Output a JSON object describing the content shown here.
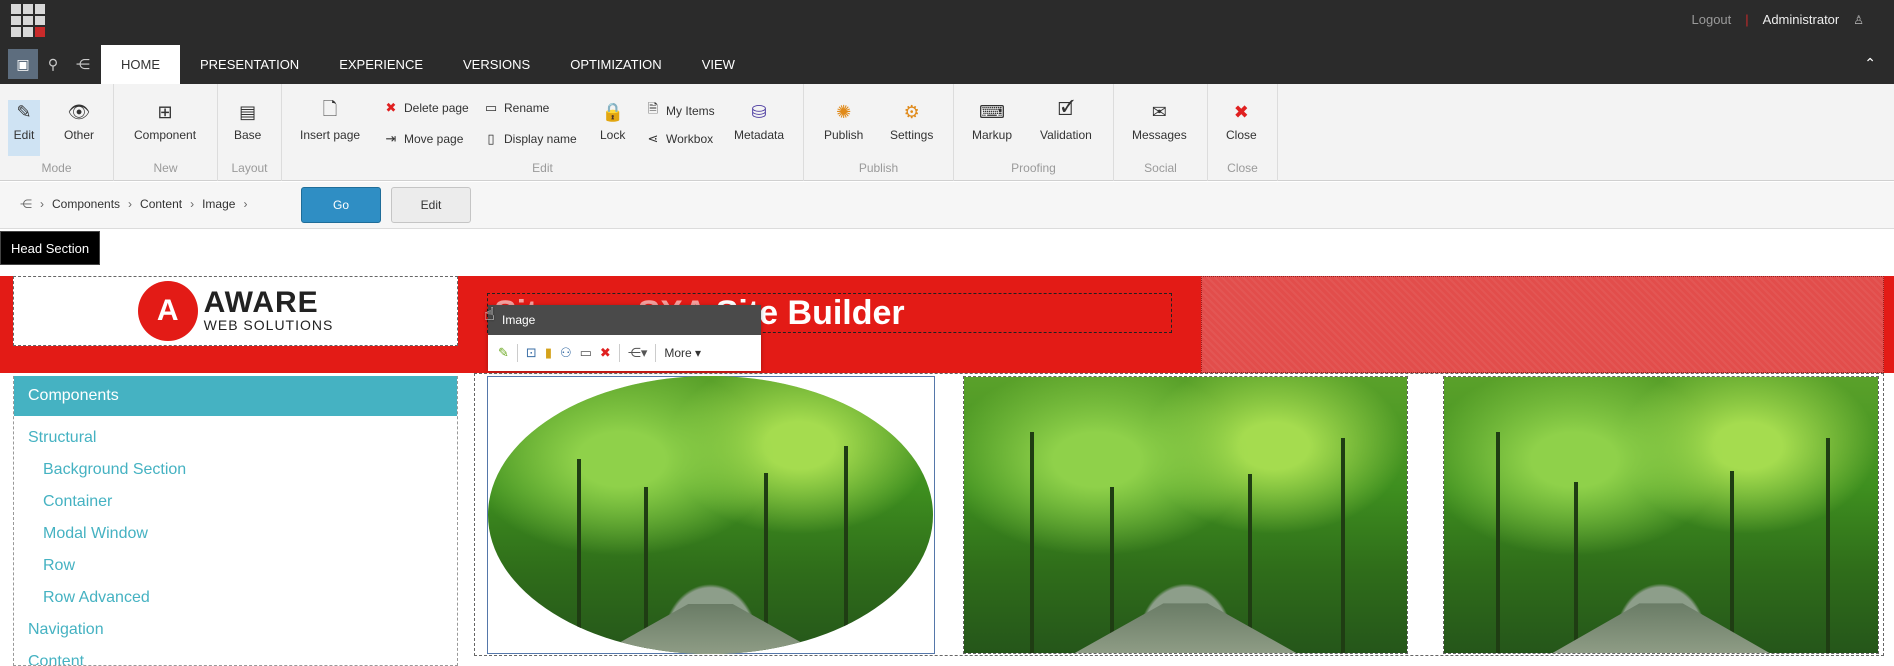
{
  "topbar": {
    "logout": "Logout",
    "separator": "|",
    "user": "Administrator"
  },
  "tabs": [
    "HOME",
    "PRESENTATION",
    "EXPERIENCE",
    "VERSIONS",
    "OPTIMIZATION",
    "VIEW"
  ],
  "ribbon": {
    "mode": {
      "label": "Mode",
      "edit": "Edit",
      "other": "Other"
    },
    "new": {
      "label": "New",
      "component": "Component"
    },
    "layout": {
      "label": "Layout",
      "base": "Base"
    },
    "edit": {
      "label": "Edit",
      "insert_page": "Insert page",
      "delete_page": "Delete page",
      "move_page": "Move page",
      "rename": "Rename",
      "display_name": "Display name",
      "lock": "Lock",
      "my_items": "My Items",
      "workbox": "Workbox",
      "metadata": "Metadata"
    },
    "publish": {
      "label": "Publish",
      "publish": "Publish",
      "settings": "Settings"
    },
    "proofing": {
      "label": "Proofing",
      "markup": "Markup",
      "validation": "Validation"
    },
    "social": {
      "label": "Social",
      "messages": "Messages"
    },
    "close": {
      "label": "Close",
      "close": "Close"
    }
  },
  "breadcrumb": {
    "items": [
      "Components",
      "Content",
      "Image"
    ],
    "go": "Go",
    "edit": "Edit"
  },
  "head_section": "Head Section",
  "banner": {
    "logo_line1": "AWARE",
    "logo_line2": "WEB SOLUTIONS",
    "title_hidden": "Sitecore SXA",
    "title_visible": "Site Builder"
  },
  "component_toolbar": {
    "title": "Image",
    "more": "More"
  },
  "sidebar": {
    "header": "Components",
    "items": [
      {
        "label": "Structural",
        "level": 0
      },
      {
        "label": "Background Section",
        "level": 1
      },
      {
        "label": "Container",
        "level": 1
      },
      {
        "label": "Modal Window",
        "level": 1
      },
      {
        "label": "Row",
        "level": 1
      },
      {
        "label": "Row Advanced",
        "level": 1
      },
      {
        "label": "Navigation",
        "level": 0
      },
      {
        "label": "Content",
        "level": 0
      }
    ]
  },
  "colors": {
    "banner_red": "#e31b16",
    "accent_teal": "#45b2c2",
    "go_blue": "#2f8ec4",
    "topbar_dark": "#2b2b2b"
  }
}
